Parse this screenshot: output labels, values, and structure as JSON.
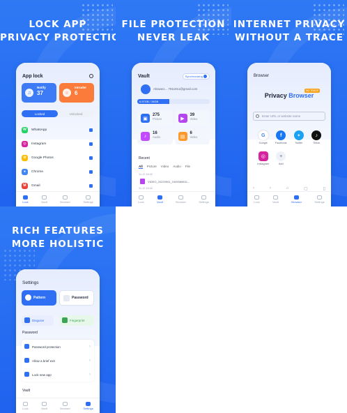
{
  "colors": {
    "brand_blue": "#2f6ff3",
    "notify_blue": "#3d7bf6",
    "intruder_orange": "#fb7c3a"
  },
  "panel1": {
    "headline": [
      "LOCK APP",
      "PRIVACY PROTECTION"
    ],
    "title": "App lock",
    "notify": {
      "label": "Notify",
      "count": "37"
    },
    "intruder": {
      "label": "Intruder",
      "count": "6"
    },
    "tabs": [
      "Locked",
      "Unlocked"
    ],
    "apps": [
      {
        "name": "WhatsApp",
        "color": "#25d366",
        "glyph": "W"
      },
      {
        "name": "Instagram",
        "color": "#d6249f",
        "glyph": "◎"
      },
      {
        "name": "Google Photos",
        "color": "#fbbc05",
        "glyph": "✿"
      },
      {
        "name": "Chrome",
        "color": "#4285f4",
        "glyph": "●"
      },
      {
        "name": "Gmail",
        "color": "#ea4335",
        "glyph": "M"
      }
    ],
    "nav": [
      "Lock",
      "Vault",
      "Browser",
      "Settings"
    ]
  },
  "panel2": {
    "headline": [
      "FILE PROTECTION",
      "NEVER LEAK"
    ],
    "title": "Vault",
    "sync": "Synchronizing",
    "account": "Aksww1... 7811911@gmail.com",
    "storage_used": "6.57GB / 15GB",
    "storage_fraction": 0.44,
    "files": [
      {
        "count": "275",
        "label": "Picture",
        "color": "#2f6ff3",
        "glyph": "▣"
      },
      {
        "count": "39",
        "label": "Video",
        "color": "#b445ef",
        "glyph": "▶"
      },
      {
        "count": "16",
        "label": "Audio",
        "color": "#c24bff",
        "glyph": "♪"
      },
      {
        "count": "6",
        "label": "Video",
        "color": "#fd9a2b",
        "glyph": "▤"
      }
    ],
    "recent": "Recent",
    "recent_tabs": [
      "All",
      "Picture",
      "Video",
      "Audio",
      "File"
    ],
    "recent_time1": "11-12 16:42",
    "recent_item": "VIDEO_20220901_1949089831...",
    "recent_time2": "11-12 16:42",
    "nav": [
      "Lock",
      "Vault",
      "Browser",
      "Settings"
    ]
  },
  "panel3": {
    "headline": [
      "INTERNET PRIVACY",
      "WITHOUT A TRACE"
    ],
    "title": "Browser",
    "brand_privacy": "Privacy",
    "brand_browser": "Browser",
    "badge": "NO TRACE",
    "url_placeholder": "Enter URL or website name",
    "sites": [
      {
        "name": "Google",
        "color": "#ffffff",
        "glyph": "G",
        "fg": "#4285f4"
      },
      {
        "name": "Facebook",
        "color": "#1877f2",
        "glyph": "f",
        "fg": "#ffffff"
      },
      {
        "name": "Twitter",
        "color": "#1da1f2",
        "glyph": "🐦",
        "fg": "#ffffff"
      },
      {
        "name": "Tiktok",
        "color": "#111111",
        "glyph": "♪",
        "fg": "#ffffff"
      },
      {
        "name": "Instagram",
        "color": "#d6249f",
        "glyph": "◎",
        "fg": "#ffffff"
      },
      {
        "name": "Add",
        "color": "#eef1f7",
        "glyph": "+",
        "fg": "#8a92a4"
      }
    ],
    "nav": [
      "Lock",
      "Vault",
      "Browser",
      "Settings"
    ]
  },
  "panel4": {
    "headline": [
      "RICH FEATURES",
      "MORE HOLISTIC"
    ],
    "title": "Settings",
    "pattern": "Pattern",
    "password": "Password",
    "disguise": "Disguise",
    "fingerprint": "Fingerprint",
    "section_password": "Password",
    "rows": [
      "Password protection",
      "Allow a brief exit",
      "Lock new app"
    ],
    "section_vault": "Vault",
    "nav": [
      "Lock",
      "Vault",
      "Browser",
      "Settings"
    ]
  }
}
